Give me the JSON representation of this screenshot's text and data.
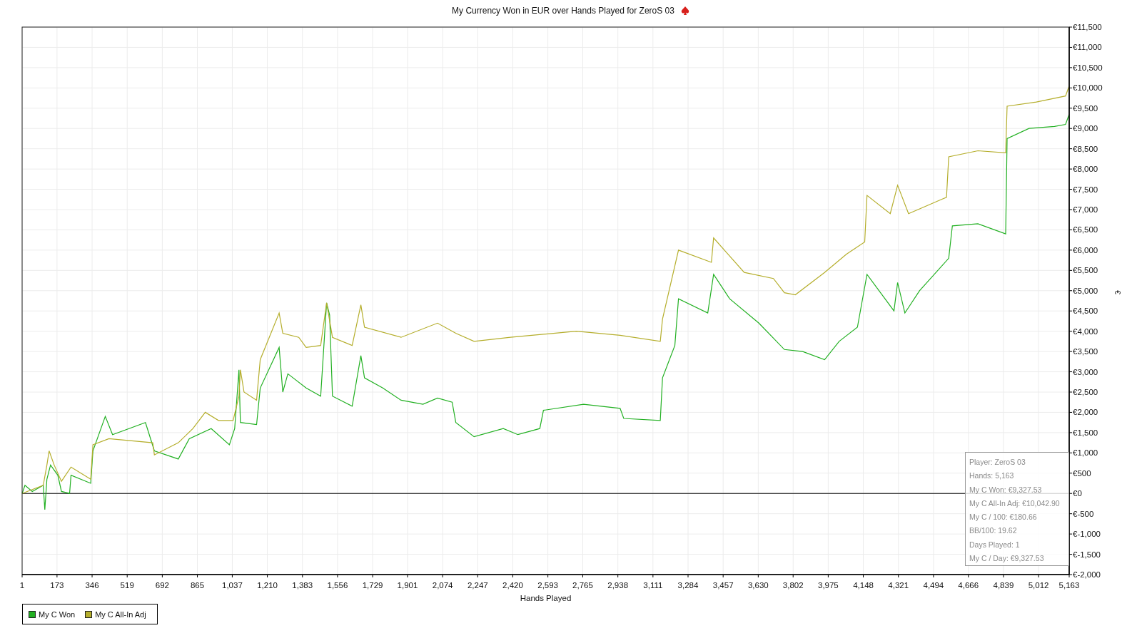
{
  "chart_data": {
    "type": "line",
    "title": "My Currency Won in EUR over Hands Played for ZeroS 03",
    "xlabel": "Hands Played",
    "ylabel": "€",
    "xlim": [
      1,
      5163
    ],
    "ylim": [
      -2000,
      11500
    ],
    "grid": true,
    "xticks": [
      {
        "value": 1,
        "label": "1"
      },
      {
        "value": 173,
        "label": "173"
      },
      {
        "value": 346,
        "label": "346"
      },
      {
        "value": 519,
        "label": "519"
      },
      {
        "value": 692,
        "label": "692"
      },
      {
        "value": 865,
        "label": "865"
      },
      {
        "value": 1037,
        "label": "1,037"
      },
      {
        "value": 1210,
        "label": "1,210"
      },
      {
        "value": 1383,
        "label": "1,383"
      },
      {
        "value": 1556,
        "label": "1,556"
      },
      {
        "value": 1729,
        "label": "1,729"
      },
      {
        "value": 1901,
        "label": "1,901"
      },
      {
        "value": 2074,
        "label": "2,074"
      },
      {
        "value": 2247,
        "label": "2,247"
      },
      {
        "value": 2420,
        "label": "2,420"
      },
      {
        "value": 2593,
        "label": "2,593"
      },
      {
        "value": 2765,
        "label": "2,765"
      },
      {
        "value": 2938,
        "label": "2,938"
      },
      {
        "value": 3111,
        "label": "3,111"
      },
      {
        "value": 3284,
        "label": "3,284"
      },
      {
        "value": 3457,
        "label": "3,457"
      },
      {
        "value": 3630,
        "label": "3,630"
      },
      {
        "value": 3802,
        "label": "3,802"
      },
      {
        "value": 3975,
        "label": "3,975"
      },
      {
        "value": 4148,
        "label": "4,148"
      },
      {
        "value": 4321,
        "label": "4,321"
      },
      {
        "value": 4494,
        "label": "4,494"
      },
      {
        "value": 4666,
        "label": "4,666"
      },
      {
        "value": 4839,
        "label": "4,839"
      },
      {
        "value": 5012,
        "label": "5,012"
      },
      {
        "value": 5163,
        "label": "5,163"
      }
    ],
    "yticks": [
      {
        "value": 11500,
        "label": "€11,500"
      },
      {
        "value": 11000,
        "label": "€11,000"
      },
      {
        "value": 10500,
        "label": "€10,500"
      },
      {
        "value": 10000,
        "label": "€10,000"
      },
      {
        "value": 9500,
        "label": "€9,500"
      },
      {
        "value": 9000,
        "label": "€9,000"
      },
      {
        "value": 8500,
        "label": "€8,500"
      },
      {
        "value": 8000,
        "label": "€8,000"
      },
      {
        "value": 7500,
        "label": "€7,500"
      },
      {
        "value": 7000,
        "label": "€7,000"
      },
      {
        "value": 6500,
        "label": "€6,500"
      },
      {
        "value": 6000,
        "label": "€6,000"
      },
      {
        "value": 5500,
        "label": "€5,500"
      },
      {
        "value": 5000,
        "label": "€5,000"
      },
      {
        "value": 4500,
        "label": "€4,500"
      },
      {
        "value": 4000,
        "label": "€4,000"
      },
      {
        "value": 3500,
        "label": "€3,500"
      },
      {
        "value": 3000,
        "label": "€3,000"
      },
      {
        "value": 2500,
        "label": "€2,500"
      },
      {
        "value": 2000,
        "label": "€2,000"
      },
      {
        "value": 1500,
        "label": "€1,500"
      },
      {
        "value": 1000,
        "label": "€1,000"
      },
      {
        "value": 500,
        "label": "€500"
      },
      {
        "value": 0,
        "label": "€0"
      },
      {
        "value": -500,
        "label": "€-500"
      },
      {
        "value": -1000,
        "label": "€-1,000"
      },
      {
        "value": -1500,
        "label": "€-1,500"
      },
      {
        "value": -2000,
        "label": "€-2,000"
      }
    ],
    "series": [
      {
        "name": "My C Won",
        "color": "#22b022",
        "x": [
          1,
          15,
          51,
          105,
          113,
          123,
          141,
          177,
          195,
          235,
          242,
          339,
          350,
          411,
          447,
          609,
          653,
          771,
          825,
          933,
          1023,
          1049,
          1070,
          1077,
          1157,
          1175,
          1268,
          1286,
          1311,
          1401,
          1473,
          1502,
          1517,
          1531,
          1628,
          1671,
          1689,
          1779,
          1869,
          1977,
          2049,
          2121,
          2139,
          2229,
          2373,
          2445,
          2553,
          2571,
          2769,
          2949,
          2967,
          3147,
          3158,
          3219,
          3237,
          3381,
          3410,
          3489,
          3633,
          3759,
          3849,
          3957,
          4029,
          4119,
          4166,
          4299,
          4317,
          4353,
          4425,
          4569,
          4587,
          4713,
          4850,
          4857,
          4965,
          5091,
          5145,
          5163
        ],
        "values": [
          0,
          200,
          50,
          200,
          -400,
          350,
          700,
          450,
          50,
          0,
          450,
          250,
          1050,
          1900,
          1450,
          1750,
          1050,
          850,
          1350,
          1600,
          1200,
          1600,
          3050,
          1750,
          1700,
          2600,
          3600,
          2500,
          2950,
          2600,
          2400,
          4700,
          4400,
          2400,
          2150,
          3400,
          2850,
          2600,
          2300,
          2200,
          2350,
          2250,
          1750,
          1400,
          1600,
          1450,
          1600,
          2050,
          2200,
          2100,
          1850,
          1800,
          2850,
          3650,
          4800,
          4450,
          5400,
          4800,
          4200,
          3550,
          3500,
          3300,
          3750,
          4100,
          5400,
          4500,
          5200,
          4450,
          5000,
          5800,
          6600,
          6650,
          6400,
          8750,
          9000,
          9050,
          9100,
          9350
        ]
      },
      {
        "name": "My C All-In Adj",
        "color": "#b5ae2c",
        "x": [
          1,
          105,
          123,
          134,
          159,
          195,
          242,
          339,
          350,
          429,
          645,
          653,
          771,
          843,
          904,
          969,
          1041,
          1070,
          1077,
          1095,
          1157,
          1175,
          1268,
          1286,
          1365,
          1401,
          1473,
          1502,
          1531,
          1628,
          1671,
          1689,
          1869,
          2049,
          2139,
          2229,
          2409,
          2733,
          2949,
          3147,
          3158,
          3237,
          3399,
          3410,
          3561,
          3705,
          3759,
          3813,
          3957,
          4065,
          4155,
          4166,
          4281,
          4317,
          4371,
          4533,
          4558,
          4569,
          4713,
          4850,
          4857,
          5001,
          5145,
          5163
        ],
        "values": [
          0,
          200,
          700,
          1050,
          700,
          300,
          650,
          350,
          1200,
          1350,
          1250,
          950,
          1250,
          1600,
          2000,
          1800,
          1800,
          2400,
          3050,
          2500,
          2300,
          3300,
          4450,
          3950,
          3850,
          3600,
          3650,
          4700,
          3850,
          3650,
          4650,
          4100,
          3850,
          4200,
          3950,
          3750,
          3850,
          4000,
          3900,
          3750,
          4300,
          6000,
          5700,
          6300,
          5450,
          5300,
          4950,
          4900,
          5450,
          5900,
          6200,
          7350,
          6900,
          7600,
          6900,
          7250,
          7300,
          8300,
          8450,
          8400,
          9550,
          9650,
          9800,
          10050
        ]
      }
    ]
  },
  "tooltip": [
    "Player: ZeroS 03",
    "Hands: 5,163",
    "My C Won: €9,327.53",
    "My C All-In Adj: €10,042.90",
    "My C / 100: €180.66",
    "BB/100: 19.62",
    "Days Played: 1",
    "My C / Day: €9,327.53"
  ]
}
